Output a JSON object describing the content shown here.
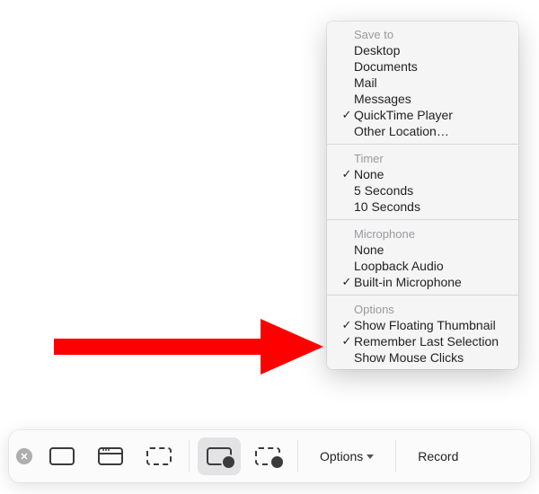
{
  "menu": {
    "sections": [
      {
        "heading": "Save to",
        "items": [
          {
            "label": "Desktop",
            "checked": false
          },
          {
            "label": "Documents",
            "checked": false
          },
          {
            "label": "Mail",
            "checked": false
          },
          {
            "label": "Messages",
            "checked": false
          },
          {
            "label": "QuickTime Player",
            "checked": true
          },
          {
            "label": "Other Location…",
            "checked": false
          }
        ]
      },
      {
        "heading": "Timer",
        "items": [
          {
            "label": "None",
            "checked": true
          },
          {
            "label": "5 Seconds",
            "checked": false
          },
          {
            "label": "10 Seconds",
            "checked": false
          }
        ]
      },
      {
        "heading": "Microphone",
        "items": [
          {
            "label": "None",
            "checked": false
          },
          {
            "label": "Loopback Audio",
            "checked": false
          },
          {
            "label": "Built-in Microphone",
            "checked": true
          }
        ]
      },
      {
        "heading": "Options",
        "items": [
          {
            "label": "Show Floating Thumbnail",
            "checked": true
          },
          {
            "label": "Remember Last Selection",
            "checked": true
          },
          {
            "label": "Show Mouse Clicks",
            "checked": false
          }
        ]
      }
    ]
  },
  "toolbar": {
    "options_label": "Options",
    "record_label": "Record"
  },
  "checkmark": "✓"
}
